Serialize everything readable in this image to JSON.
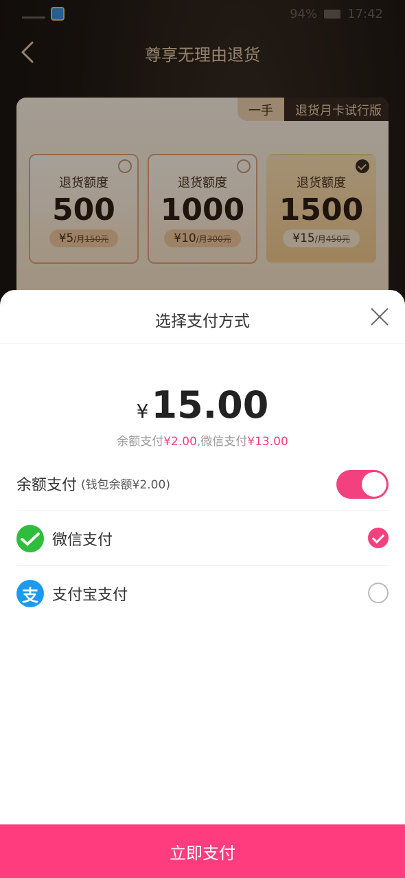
{
  "status_bar": {
    "battery": "94%",
    "time": "17:42"
  },
  "header": {
    "title": "尊享无理由退货"
  },
  "card": {
    "tag_left": "一手",
    "tag_right": "退货月卡试行版",
    "plans": [
      {
        "label": "退货额度",
        "amount": "500",
        "price": "¥5",
        "unit": "/月",
        "original": "150元",
        "selected": false
      },
      {
        "label": "退货额度",
        "amount": "1000",
        "price": "¥10",
        "unit": "/月",
        "original": "300元",
        "selected": false
      },
      {
        "label": "退货额度",
        "amount": "1500",
        "price": "¥15",
        "unit": "/月",
        "original": "450元",
        "selected": true
      }
    ]
  },
  "sheet": {
    "title": "选择支付方式",
    "currency": "¥",
    "total": "15.00",
    "split": {
      "balance_label": "余额支付",
      "balance_value": "¥2.00",
      "sep": ",",
      "wechat_label": "微信支付",
      "wechat_value": "¥13.00"
    },
    "balance_row": {
      "label": "余额支付",
      "sub": "(钱包余额¥2.00)",
      "enabled": true
    },
    "methods": [
      {
        "label": "微信支付",
        "icon": "wechat-icon",
        "selected": true
      },
      {
        "label": "支付宝支付",
        "icon": "alipay-icon",
        "icon_glyph": "支",
        "selected": false
      }
    ],
    "pay_button": "立即支付"
  },
  "colors": {
    "accent": "#f2417e",
    "button": "#fe3c7e",
    "wechat": "#2fbd3c",
    "alipay": "#1a9af0"
  }
}
